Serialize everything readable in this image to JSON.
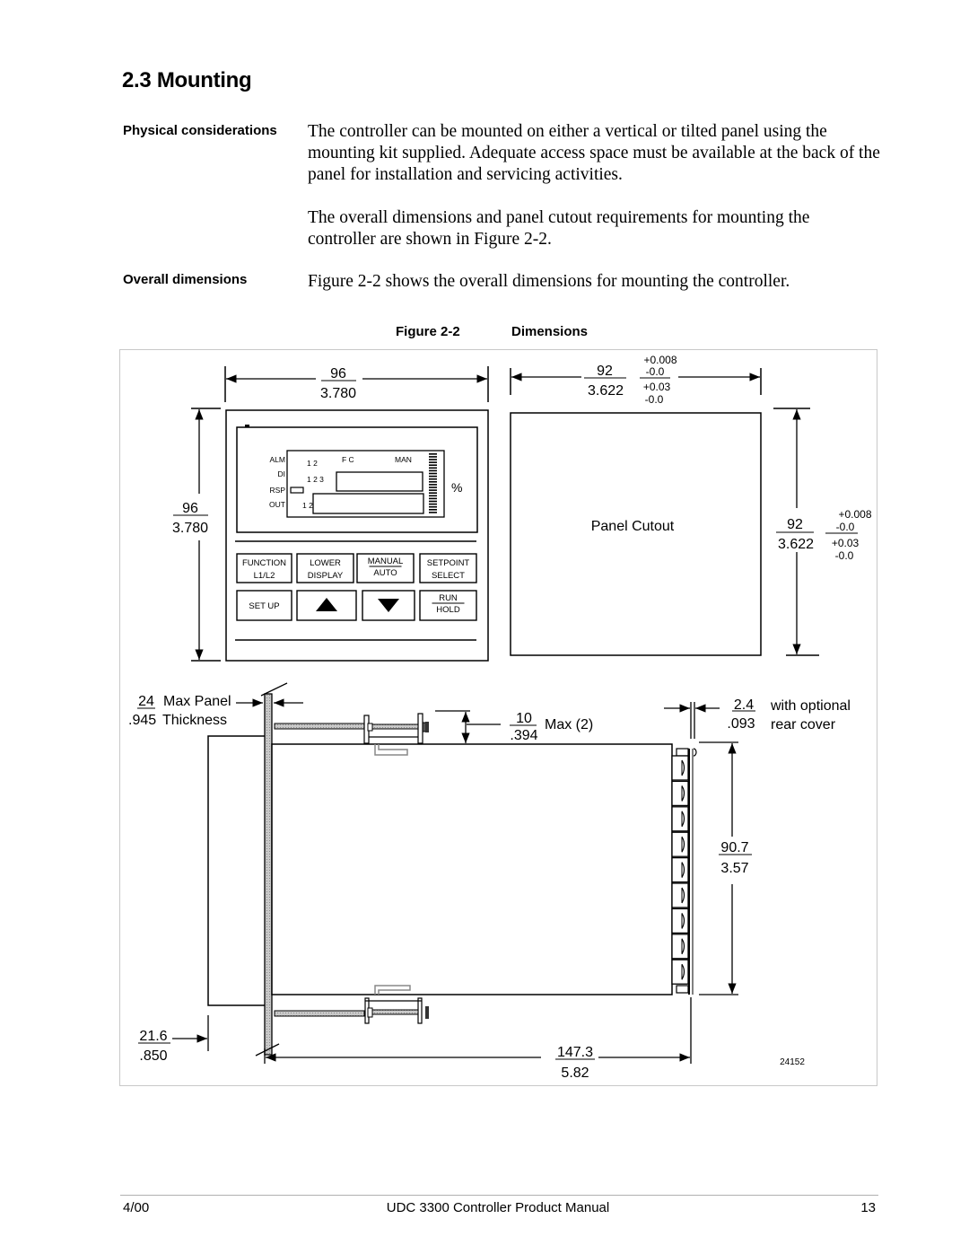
{
  "section": {
    "title": "2.3  Mounting"
  },
  "physical": {
    "label": "Physical considerations",
    "para1": "The controller can be mounted on either a vertical or tilted panel using the mounting kit supplied. Adequate access space must be available at the back of the panel for installation and servicing activities.",
    "para2": "The overall dimensions and panel cutout requirements for mounting the controller are shown in Figure 2-2."
  },
  "overall": {
    "label": "Overall dimensions",
    "para": "Figure 2-2 shows the overall dimensions for mounting the controller."
  },
  "figure": {
    "number": "Figure 2-2",
    "title": "Dimensions",
    "drawing_id": "24152",
    "front_view": {
      "width_mm": "96",
      "width_in": "3.780",
      "height_mm": "96",
      "height_in": "3.780",
      "display": {
        "alm": "ALM",
        "alm_nums": "1 2",
        "fc": "F C",
        "man": "MAN",
        "di": "DI",
        "di_nums": "1 2 3",
        "rsp": "RSP",
        "out": "OUT",
        "out_nums": "1 2",
        "percent": "%"
      },
      "keys": [
        {
          "top": "FUNCTION",
          "bottom": "L1/L2",
          "style": "stack"
        },
        {
          "top": "LOWER",
          "bottom": "DISPLAY",
          "style": "stack"
        },
        {
          "top": "MANUAL",
          "bottom": "AUTO",
          "style": "fraction"
        },
        {
          "top": "SETPOINT",
          "bottom": "SELECT",
          "style": "stack"
        },
        {
          "top": "SET UP",
          "bottom": "",
          "style": "single"
        },
        {
          "top": "",
          "bottom": "",
          "style": "up-arrow"
        },
        {
          "top": "",
          "bottom": "",
          "style": "down-arrow"
        },
        {
          "top": "RUN",
          "bottom": "HOLD",
          "style": "fraction"
        }
      ]
    },
    "cutout": {
      "label": "Panel Cutout",
      "width_mm": "92",
      "width_in": "3.622",
      "height_mm": "92",
      "height_in": "3.622",
      "tol_mm_plus": "+0.008",
      "tol_mm_minus": "-0.0",
      "tol_in_plus": "+0.03",
      "tol_in_minus": "-0.0"
    },
    "side_view": {
      "panel_mm": "24",
      "panel_in": ".945",
      "panel_label1": "Max Panel",
      "panel_label2": "Thickness",
      "clip_mm": "10",
      "clip_in": ".394",
      "clip_label": "Max (2)",
      "cover_mm": "2.4",
      "cover_in": ".093",
      "cover_label1": "with optional",
      "cover_label2": "rear cover",
      "height_mm": "90.7",
      "height_in": "3.57",
      "bezel_mm": "21.6",
      "bezel_in": ".850",
      "depth_mm": "147.3",
      "depth_in": "5.82"
    }
  },
  "footer": {
    "date": "4/00",
    "title": "UDC 3300 Controller Product Manual",
    "page": "13"
  }
}
